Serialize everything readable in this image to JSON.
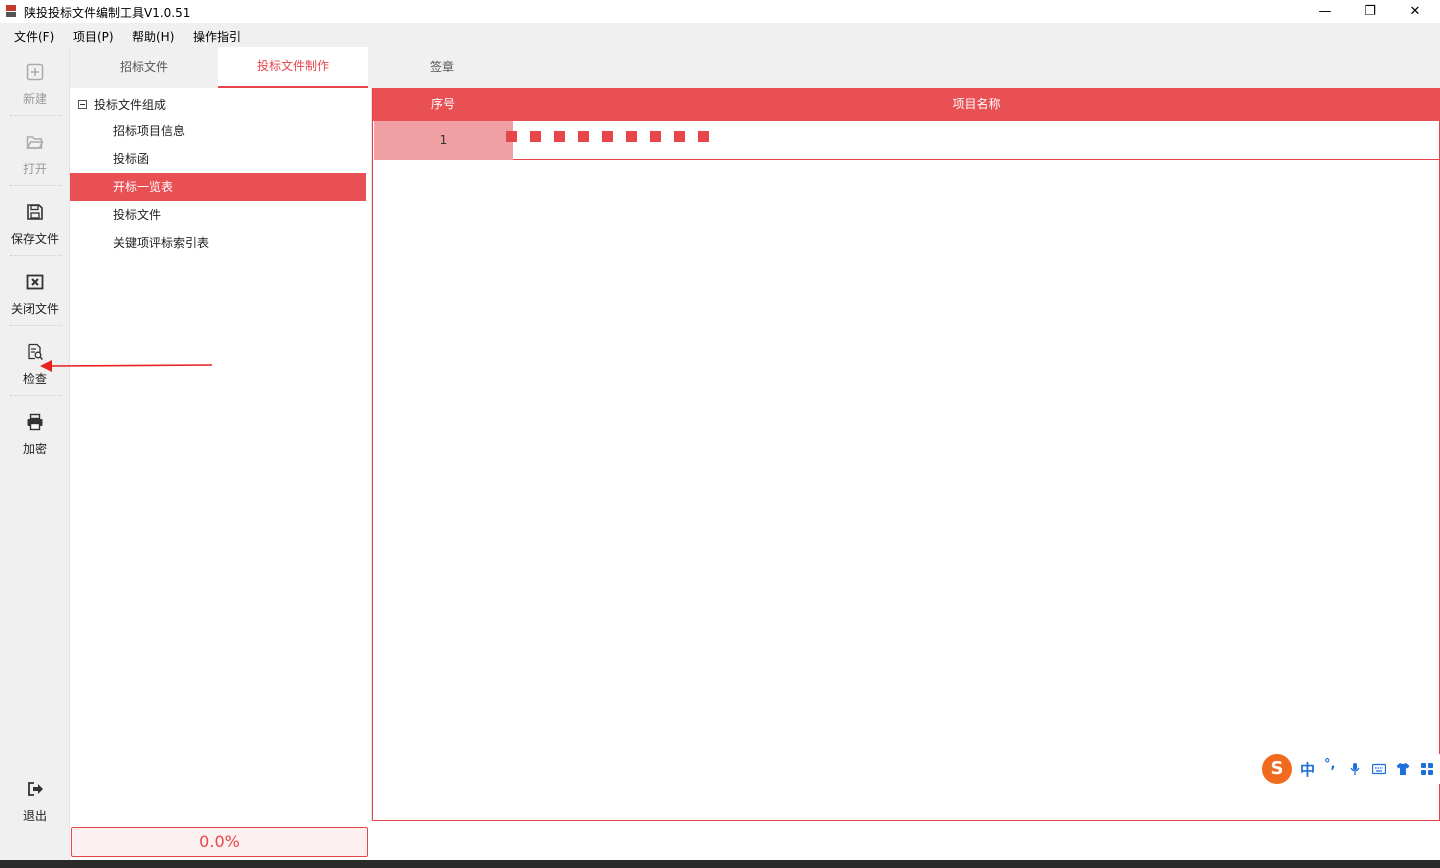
{
  "window": {
    "title": "陕投投标文件编制工具V1.0.51",
    "minimize_glyph": "—",
    "restore_glyph": "❐",
    "close_glyph": "✕"
  },
  "menu": [
    "文件(F)",
    "项目(P)",
    "帮助(H)",
    "操作指引"
  ],
  "toolbar": {
    "new_label": "新建",
    "open_label": "打开",
    "save_label": "保存文件",
    "close_label": "关闭文件",
    "check_label": "检查",
    "encrypt_label": "加密",
    "exit_label": "退出"
  },
  "tabs": [
    "招标文件",
    "投标文件制作",
    "签章"
  ],
  "tree": {
    "root_label": "投标文件组成",
    "children": [
      "招标项目信息",
      "投标函",
      "开标一览表",
      "投标文件",
      "关键项评标索引表"
    ],
    "selected_index": 2
  },
  "grid": {
    "columns": [
      "序号",
      "项目名称"
    ],
    "rows": [
      {
        "num": "1",
        "name": ""
      }
    ]
  },
  "progress_text": "0.0%",
  "ime": {
    "logo_text": "S",
    "mode_text": "中",
    "punct_text": "°,"
  },
  "colors": {
    "accent": "#e8454b",
    "header_bg": "#e85054",
    "selected_cell_bg": "#f0a0a3",
    "ime_orange": "#f26a1f"
  }
}
